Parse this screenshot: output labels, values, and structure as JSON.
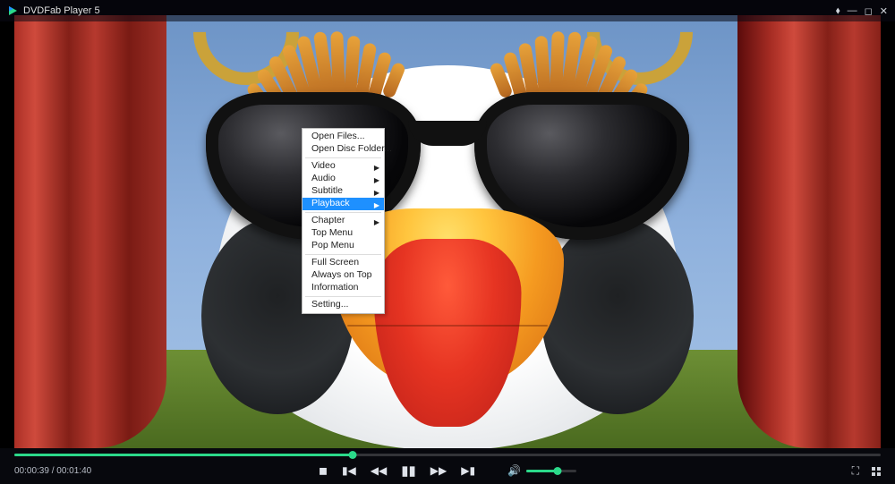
{
  "app": {
    "title": "DVDFab Player 5"
  },
  "window_buttons": {
    "pin": "⬧",
    "minimize": "—",
    "maximize": "◻",
    "close": "✕"
  },
  "context_menu": {
    "groups": [
      [
        {
          "label": "Open Files...",
          "submenu": false
        },
        {
          "label": "Open Disc Folder...",
          "submenu": false
        }
      ],
      [
        {
          "label": "Video",
          "submenu": true
        },
        {
          "label": "Audio",
          "submenu": true
        },
        {
          "label": "Subtitle",
          "submenu": true
        },
        {
          "label": "Playback",
          "submenu": true,
          "highlighted": true
        }
      ],
      [
        {
          "label": "Chapter",
          "submenu": true
        },
        {
          "label": "Top Menu",
          "submenu": false
        },
        {
          "label": "Pop Menu",
          "submenu": false
        }
      ],
      [
        {
          "label": "Full Screen",
          "submenu": false
        },
        {
          "label": "Always on Top",
          "submenu": false
        },
        {
          "label": "Information",
          "submenu": false
        }
      ],
      [
        {
          "label": "Setting...",
          "submenu": false
        }
      ]
    ]
  },
  "playback": {
    "current_time": "00:00:39",
    "total_time": "00:01:40",
    "separator": " / ",
    "progress_percent": 39,
    "volume_percent": 62
  },
  "controls": {
    "stop": "◼",
    "prev": "▮◀",
    "rewind": "◀◀",
    "play_pause": "▮▮",
    "forward": "▶▶",
    "next": "▶▮",
    "volume": "🔊",
    "fullscreen": "⛶"
  }
}
